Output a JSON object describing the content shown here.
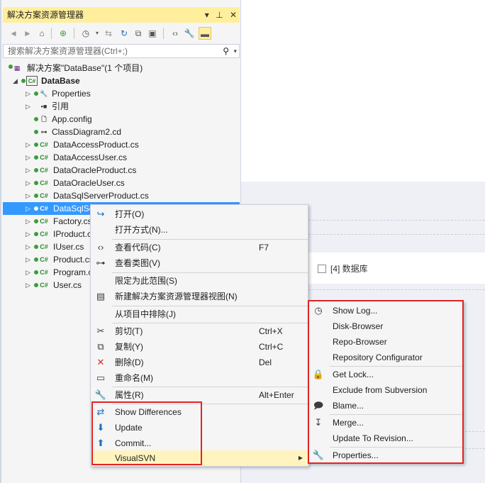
{
  "solution_explorer": {
    "title": "解决方案资源管理器",
    "title_buttons": [
      "▾",
      "⊥",
      "✕"
    ],
    "search_placeholder": "搜索解决方案资源管理器(Ctrl+;)",
    "solution_label": "解决方案\"DataBase\"(1 个项目)",
    "project_label": "DataBase",
    "items": [
      {
        "label": "Properties"
      },
      {
        "label": "引用"
      },
      {
        "label": "App.config"
      },
      {
        "label": "ClassDiagram2.cd"
      },
      {
        "label": "DataAccessProduct.cs"
      },
      {
        "label": "DataAccessUser.cs"
      },
      {
        "label": "DataOracleProduct.cs"
      },
      {
        "label": "DataOracleUser.cs"
      },
      {
        "label": "DataSqlServerProduct.cs"
      },
      {
        "label": "DataSqlSe"
      },
      {
        "label": "Factory.cs"
      },
      {
        "label": "IProduct.c"
      },
      {
        "label": "IUser.cs"
      },
      {
        "label": "Product.cs"
      },
      {
        "label": "Program.c"
      },
      {
        "label": "User.cs"
      }
    ]
  },
  "background": {
    "checkbox_label": "[4] 数据库"
  },
  "context_menu": {
    "items": [
      {
        "label": "打开(O)",
        "shortcut": ""
      },
      {
        "label": "打开方式(N)...",
        "shortcut": ""
      },
      {
        "label": "查看代码(C)",
        "shortcut": "F7"
      },
      {
        "label": "查看类图(V)",
        "shortcut": ""
      },
      {
        "label": "限定为此范围(S)",
        "shortcut": ""
      },
      {
        "label": "新建解决方案资源管理器视图(N)",
        "shortcut": ""
      },
      {
        "label": "从项目中排除(J)",
        "shortcut": ""
      },
      {
        "label": "剪切(T)",
        "shortcut": "Ctrl+X"
      },
      {
        "label": "复制(Y)",
        "shortcut": "Ctrl+C"
      },
      {
        "label": "删除(D)",
        "shortcut": "Del"
      },
      {
        "label": "重命名(M)",
        "shortcut": ""
      },
      {
        "label": "属性(R)",
        "shortcut": "Alt+Enter"
      },
      {
        "label": "Show Differences",
        "shortcut": ""
      },
      {
        "label": "Update",
        "shortcut": ""
      },
      {
        "label": "Commit...",
        "shortcut": ""
      },
      {
        "label": "VisualSVN",
        "shortcut": ""
      }
    ]
  },
  "visualsvn_submenu": {
    "items": [
      {
        "label": "Show Log..."
      },
      {
        "label": "Disk-Browser"
      },
      {
        "label": "Repo-Browser"
      },
      {
        "label": "Repository Configurator"
      },
      {
        "label": "Get Lock..."
      },
      {
        "label": "Exclude from Subversion"
      },
      {
        "label": "Blame..."
      },
      {
        "label": "Merge..."
      },
      {
        "label": "Update To Revision..."
      },
      {
        "label": "Properties..."
      }
    ]
  },
  "colors": {
    "title_bar": "#ffef9c",
    "selection": "#3399ff",
    "menu_hover": "#fff4bf",
    "highlight_box": "#e02424"
  }
}
